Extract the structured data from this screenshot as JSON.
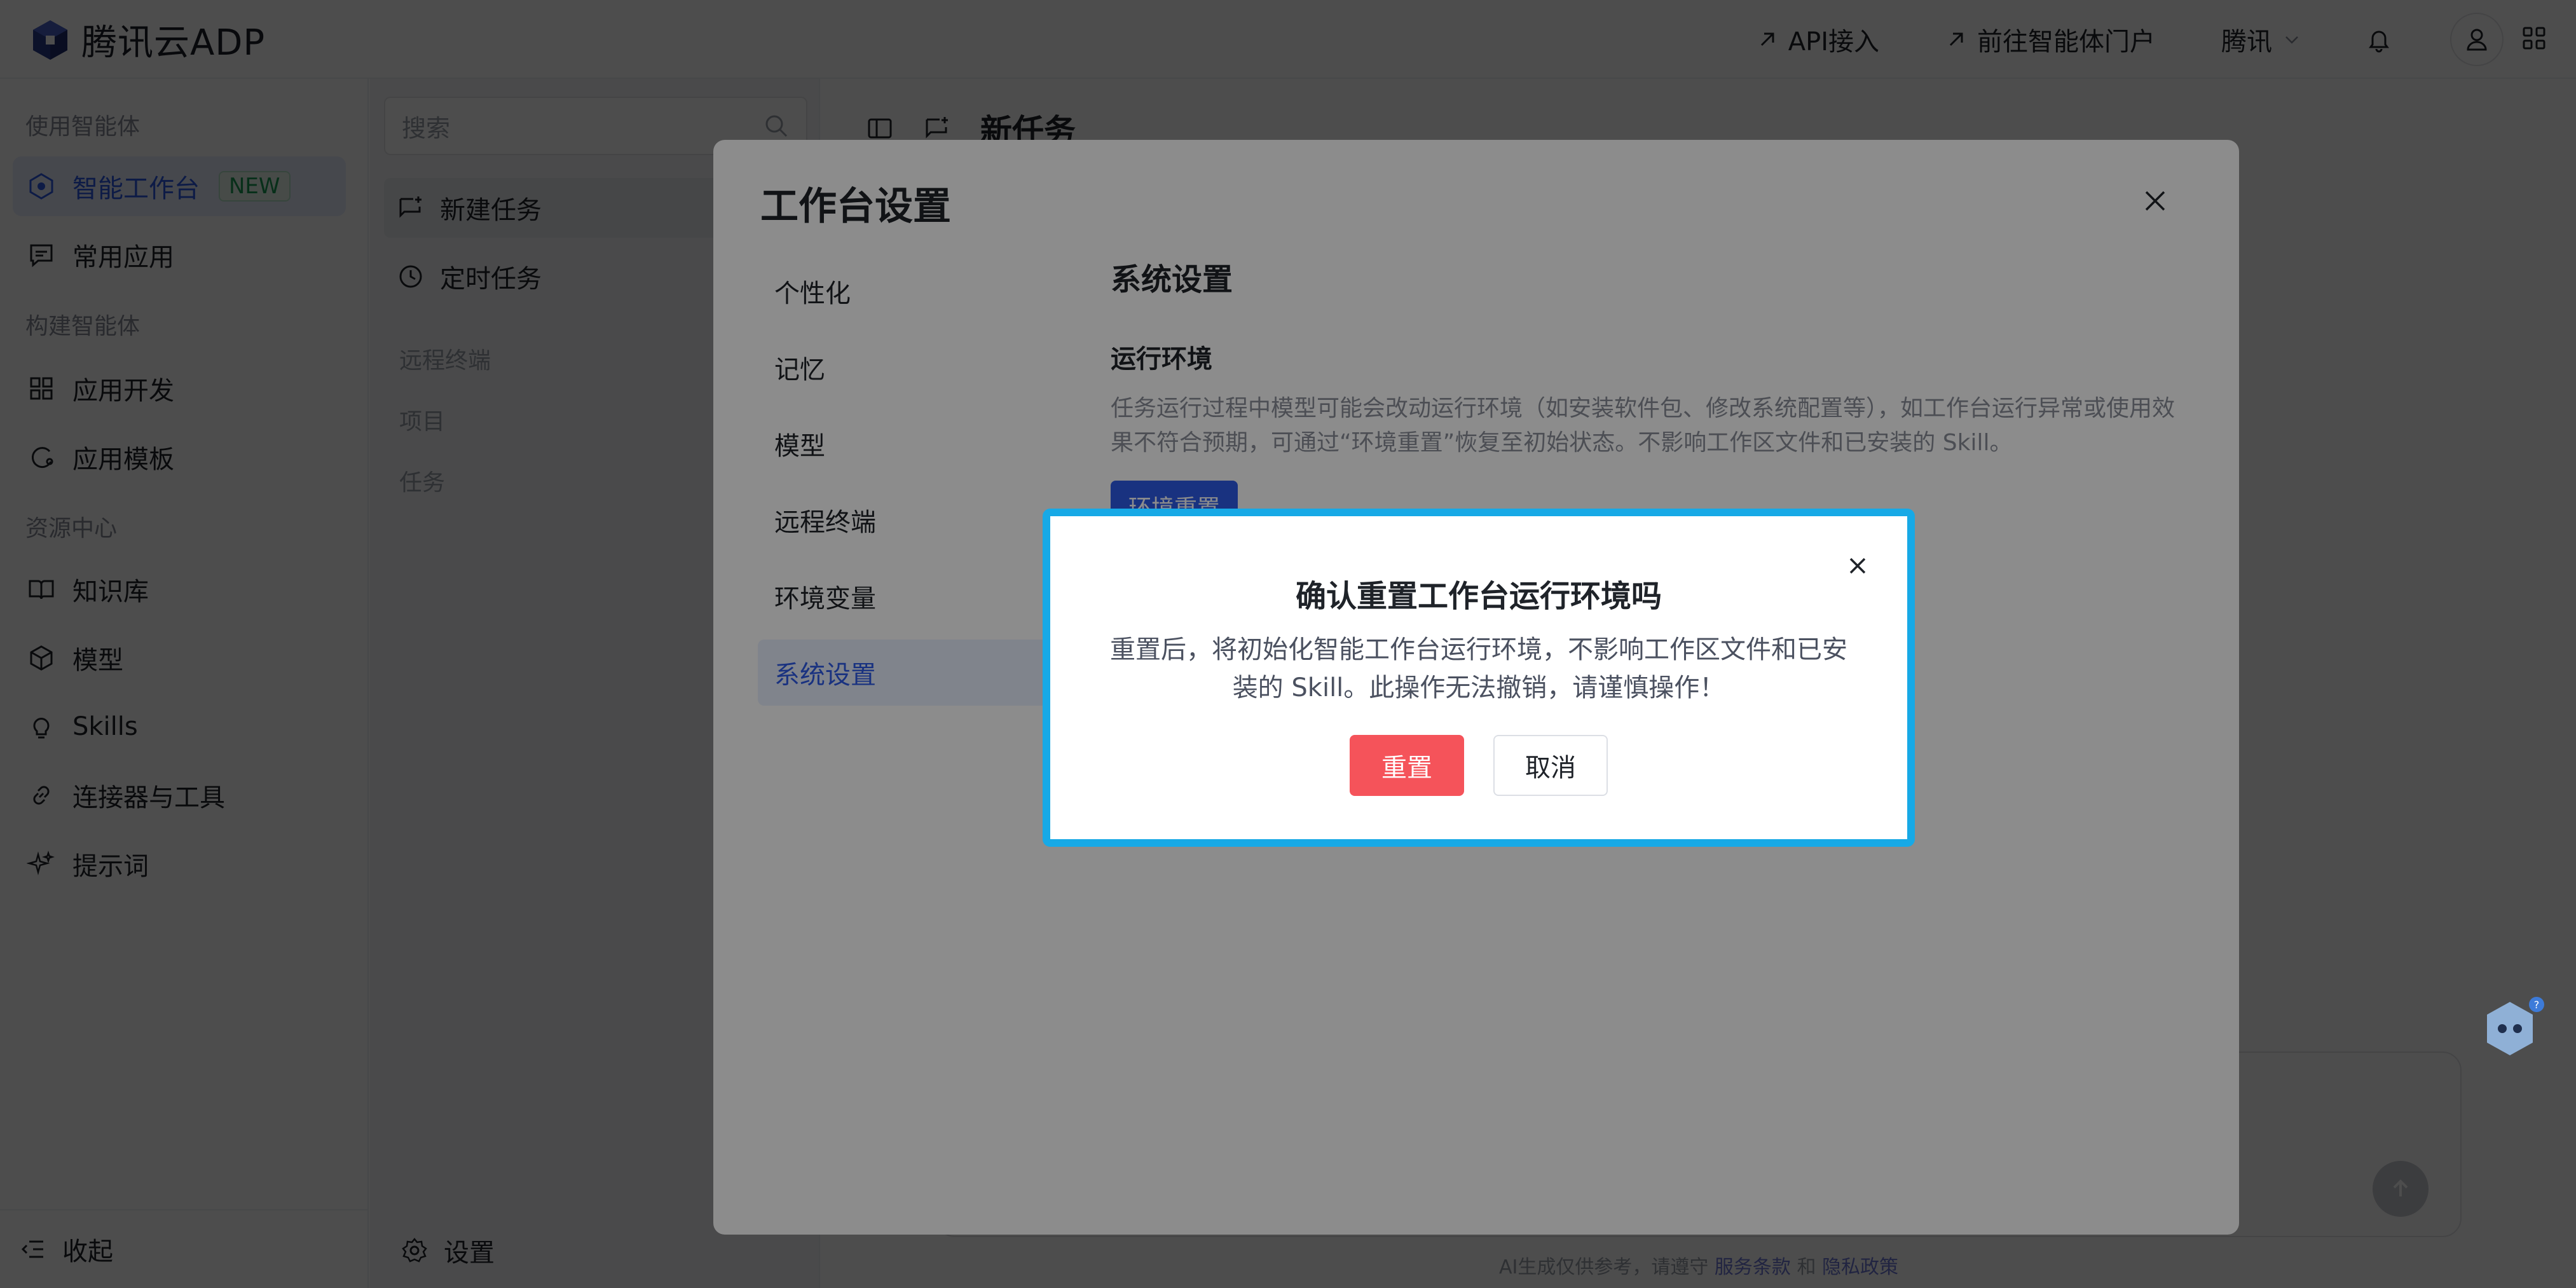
{
  "header": {
    "brand": "腾讯云ADP",
    "api_link": "API接入",
    "portal_link": "前往智能体门户",
    "tenant": "腾讯"
  },
  "sidebar": {
    "section_use": "使用智能体",
    "workbench": "智能工作台",
    "workbench_badge": "NEW",
    "common_apps": "常用应用",
    "section_build": "构建智能体",
    "app_dev": "应用开发",
    "app_templates": "应用模板",
    "section_resources": "资源中心",
    "knowledge": "知识库",
    "models": "模型",
    "skills": "Skills",
    "connectors": "连接器与工具",
    "prompts": "提示词",
    "collapse": "收起"
  },
  "col2": {
    "search_placeholder": "搜索",
    "new_task": "新建任务",
    "scheduled": "定时任务",
    "section_remote": "远程终端",
    "section_projects": "项目",
    "section_tasks": "任务",
    "settings": "设置"
  },
  "main": {
    "title": "新任务",
    "footnote_prefix": "AI生成仅供参考，请遵守",
    "footnote_terms": "服务条款",
    "footnote_and": "和",
    "footnote_privacy": "隐私政策"
  },
  "settings_dialog": {
    "title": "工作台设置",
    "nav": [
      "个性化",
      "记忆",
      "模型",
      "远程终端",
      "环境变量",
      "系统设置"
    ],
    "active_index": 5,
    "section_title": "系统设置",
    "subsection": "运行环境",
    "description": "任务运行过程中模型可能会改动运行环境（如安装软件包、修改系统配置等），如工作台运行异常或使用效果不符合预期，可通过“环境重置”恢复至初始状态。不影响工作区文件和已安装的 Skill。",
    "reset_button": "环境重置"
  },
  "confirm_dialog": {
    "title": "确认重置工作台运行环境吗",
    "body": "重置后，将初始化智能工作台运行环境，不影响工作区文件和已安装的 Skill。此操作无法撤销，请谨慎操作！",
    "confirm": "重置",
    "cancel": "取消"
  },
  "colors": {
    "accent": "#2f5bea",
    "danger": "#f5535a",
    "highlight_border": "#17a9e6",
    "new_badge": "#1a9e57"
  }
}
